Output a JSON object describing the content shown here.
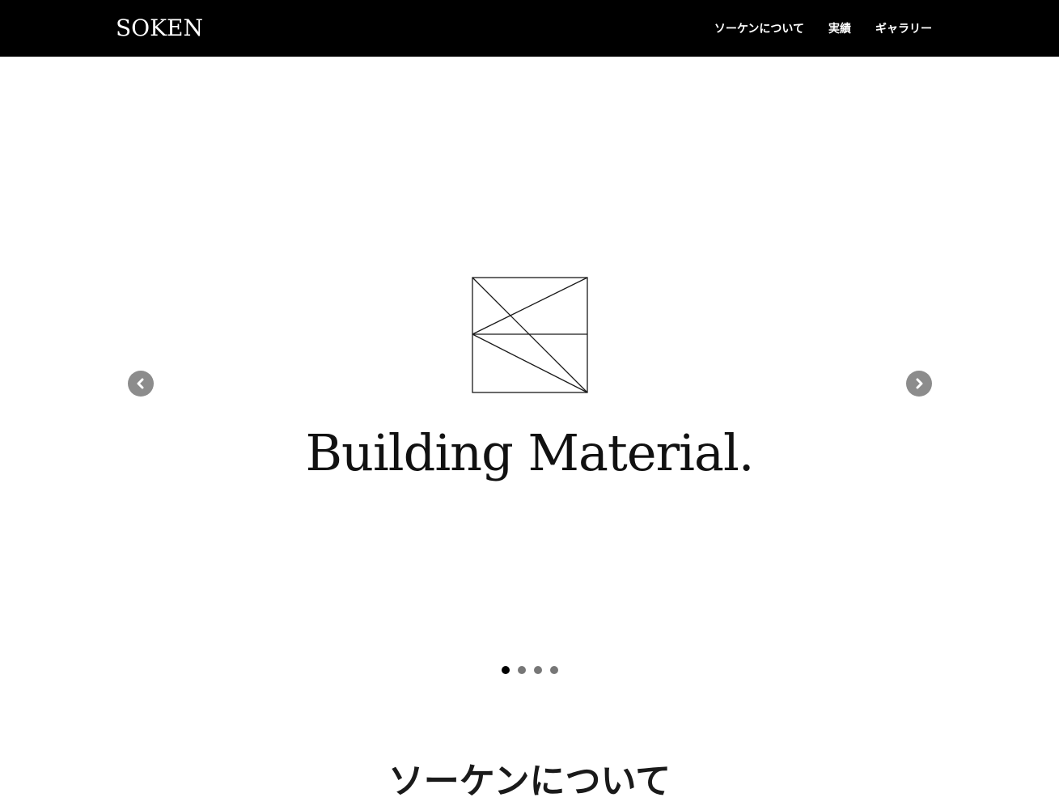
{
  "header": {
    "logo": "SOKEN",
    "nav": [
      {
        "label": "ソーケンについて"
      },
      {
        "label": "実績"
      },
      {
        "label": "ギャラリー"
      }
    ]
  },
  "hero": {
    "wordmark": "Building Material.",
    "prev_icon": "chevron-left-icon",
    "next_icon": "chevron-right-icon",
    "slides_total": 4,
    "active_slide": 1
  },
  "about": {
    "title": "ソーケンについて"
  },
  "colors": {
    "header_bg": "#000000",
    "arrow_bg": "#8c8c8c",
    "dot_active": "#000000",
    "dot_inactive": "#777777"
  }
}
